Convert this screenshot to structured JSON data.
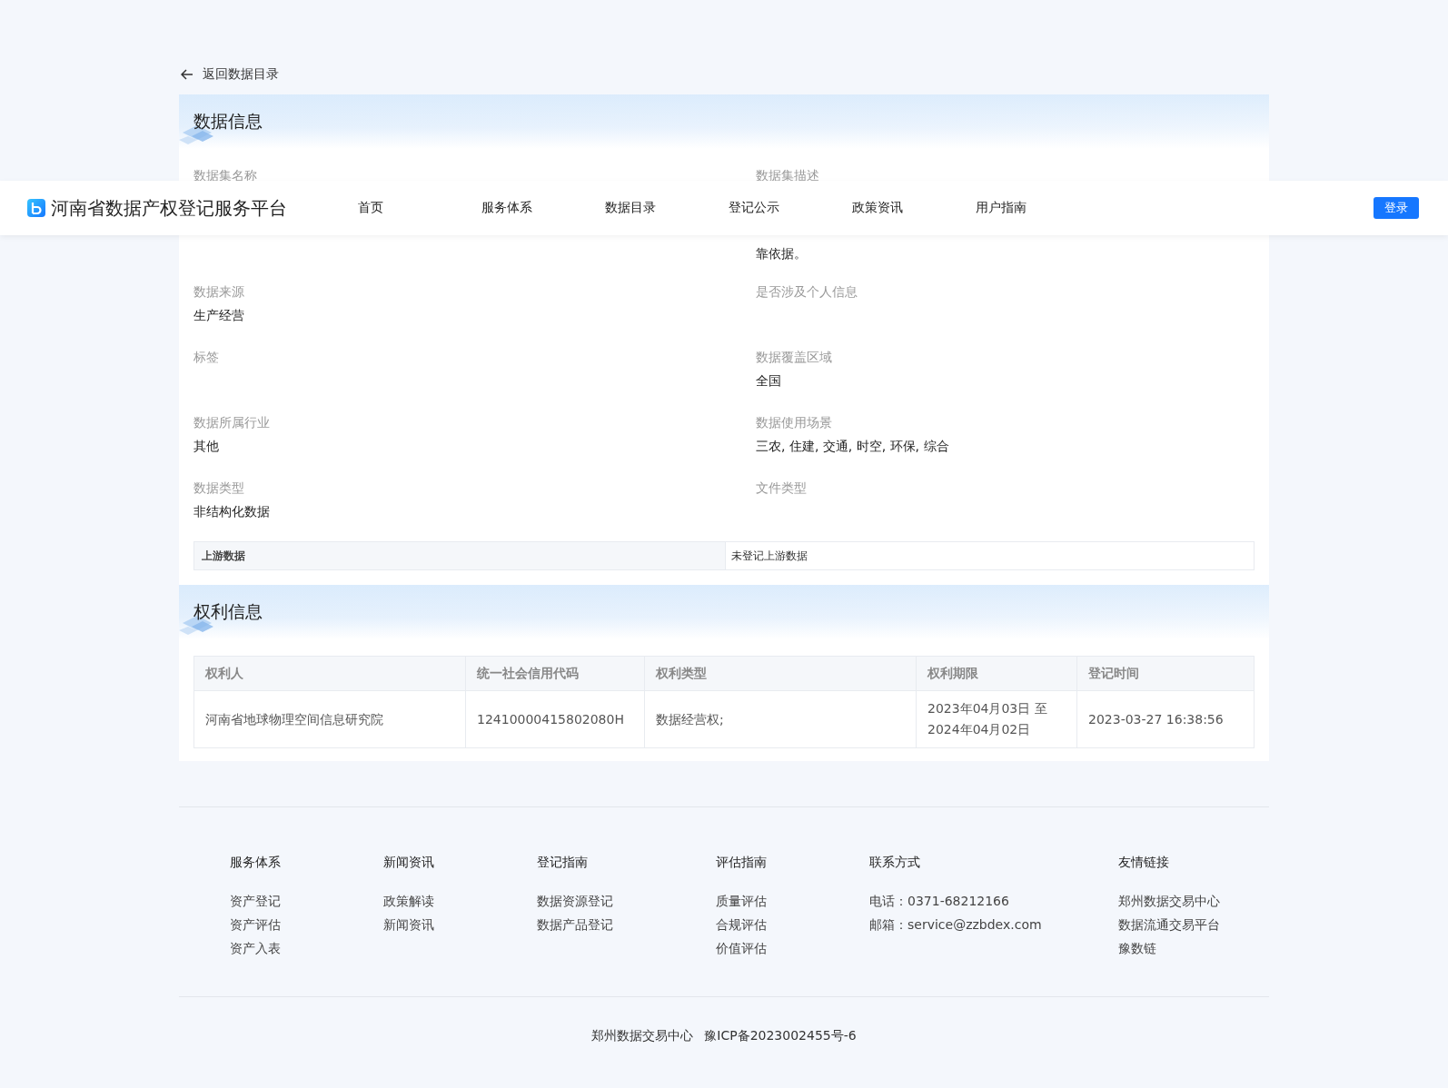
{
  "header": {
    "title": "河南省数据产权登记服务平台",
    "nav": [
      {
        "label": "首页",
        "selected": false
      },
      {
        "label": "服务体系",
        "selected": false
      },
      {
        "label": "数据目录",
        "selected": false
      },
      {
        "label": "登记公示",
        "selected": false
      },
      {
        "label": "政策资讯",
        "selected": false
      },
      {
        "label": "用户指南",
        "selected": false
      }
    ],
    "login": "登录"
  },
  "back_link": "返回数据目录",
  "data_info": {
    "title": "数据信息",
    "fields": [
      {
        "label": "数据集名称"
      },
      {
        "label": "数据集描述",
        "value": "靠依据。"
      },
      {
        "label": "数据来源",
        "value": "生产经营"
      },
      {
        "label": "是否涉及个人信息"
      },
      {
        "label": "标签"
      },
      {
        "label": "数据覆盖区域",
        "value": "全国"
      },
      {
        "label": "数据所属行业",
        "value": "其他"
      },
      {
        "label": "数据使用场景",
        "value": "三农, 住建, 交通, 时空, 环保, 综合"
      },
      {
        "label": "数据类型",
        "value": "非结构化数据"
      },
      {
        "label": "文件类型"
      }
    ],
    "upstream": {
      "label": "上游数据",
      "value": "未登记上游数据"
    }
  },
  "rights_info": {
    "title": "权利信息",
    "columns": [
      "权利人",
      "统一社会信用代码",
      "权利类型",
      "权利期限",
      "登记时间"
    ],
    "rows": [
      [
        "河南省地球物理空间信息研究院",
        "12410000415802080H",
        "数据经营权;",
        "2023年04月03日 至\n2024年04月02日",
        "2023-03-27 16:38:56"
      ]
    ]
  },
  "footer": {
    "columns": [
      {
        "title": "服务体系",
        "items": [
          "资产登记",
          "资产评估",
          "资产入表"
        ]
      },
      {
        "title": "新闻资讯",
        "items": [
          "政策解读",
          "新闻资讯"
        ]
      },
      {
        "title": "登记指南",
        "items": [
          "数据资源登记",
          "数据产品登记"
        ]
      },
      {
        "title": "评估指南",
        "items": [
          "质量评估",
          "合规评估",
          "价值评估"
        ]
      },
      {
        "title": "联系方式",
        "items": [
          "电话：0371-68212166",
          "邮箱：service@zzbdex.com"
        ]
      },
      {
        "title": "友情链接",
        "items": [
          "郑州数据交易中心",
          "数据流通交易平台",
          "豫数链"
        ]
      }
    ],
    "copyright": [
      "郑州数据交易中心",
      "豫ICP备2023002455号-6"
    ]
  }
}
